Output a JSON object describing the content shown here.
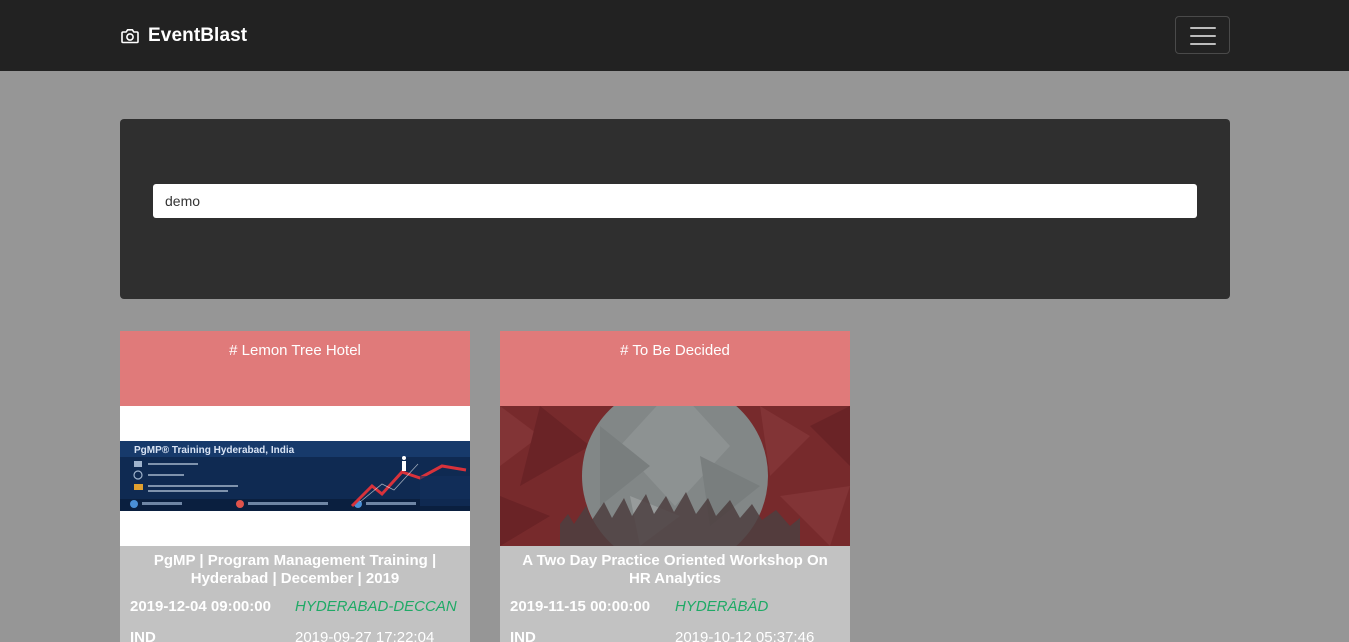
{
  "app": {
    "brand": "EventBlast",
    "brand_icon": "camera-icon",
    "menu_icon": "hamburger-menu-icon"
  },
  "search": {
    "value": "demo"
  },
  "events": [
    {
      "venue": "# Lemon Tree Hotel",
      "title": "PgMP | Program Management Training | Hyderabad | December | 2019",
      "start": "2019-12-04 09:00:00",
      "city": "HYDERABAD-DECCAN",
      "country": "IND",
      "created": "2019-09-27 17:22:04",
      "banner_text": "PgMP® Training Hyderabad, India"
    },
    {
      "venue": "# To Be Decided",
      "title": "A Two Day Practice Oriented Workshop On HR Analytics",
      "start": "2019-11-15 00:00:00",
      "city": "HYDERĀBĀD",
      "country": "IND",
      "created": "2019-10-12 05:37:46"
    }
  ],
  "colors": {
    "page_bg": "#969696",
    "navbar_bg": "#222222",
    "panel_bg": "#2f2f2f",
    "card_header": "#e07a7a",
    "card_body": "#c2c2c2",
    "city_text": "#1faa66"
  }
}
